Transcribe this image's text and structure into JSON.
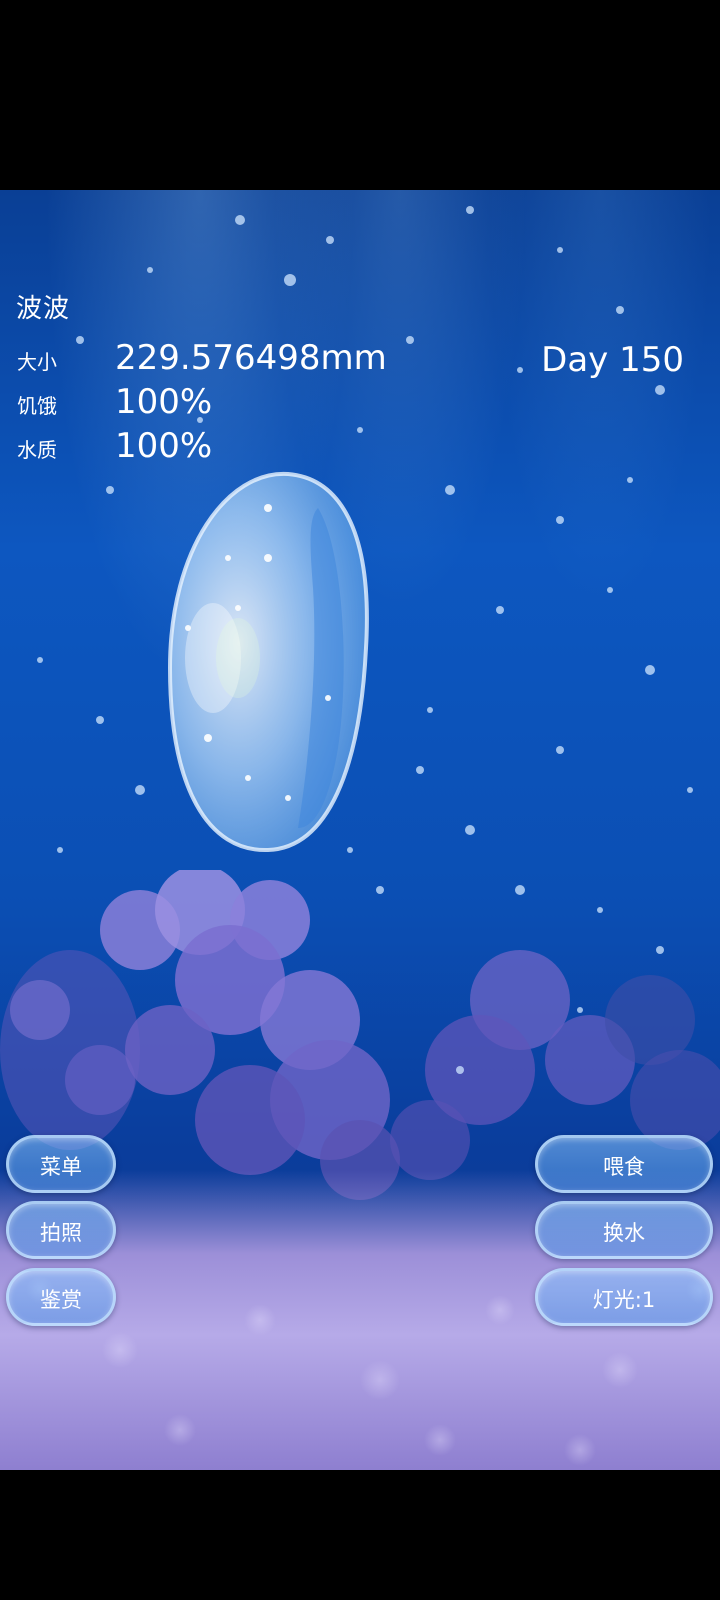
{
  "pet": {
    "name": "波波",
    "day": "Day 150"
  },
  "stats": {
    "size_label": "大小",
    "size_value": "229.576498mm",
    "hunger_label": "饥饿",
    "hunger_value": "100%",
    "water_label": "水质",
    "water_value": "100%"
  },
  "left_buttons": {
    "menu": "菜单",
    "photo": "拍照",
    "gallery": "鉴赏"
  },
  "right_buttons": {
    "feed": "喂食",
    "change_water": "换水",
    "light": "灯光:1"
  },
  "colors": {
    "water_top": "#0a3f95",
    "water_mid": "#0d57c0",
    "sand": "#b6aae8",
    "button_border": "#c8e6ff"
  }
}
